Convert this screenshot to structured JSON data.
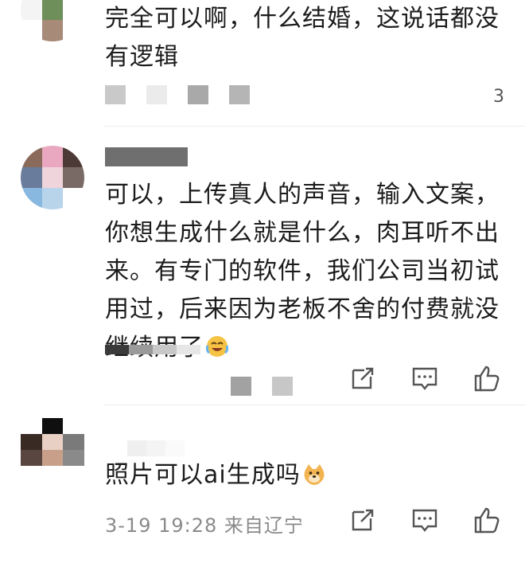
{
  "comments": [
    {
      "text": "完全可以啊，什么结婚，这说话都没有逻辑",
      "like_count": "3"
    },
    {
      "text": "可以，上传真人的声音，输入文案，你想生成什么就是什么，肉耳听不出来。有专门的软件，我们公司当初试用过，后来因为老板不舍的付费就没继续用了",
      "emoji": "laughing-crying-emoji",
      "actions": {
        "share": "share-icon",
        "reply": "comment-icon",
        "like": "thumbs-up-icon"
      }
    },
    {
      "text": "照片可以ai生成吗",
      "emoji": "doge-emoji",
      "meta": "3-19 19:28 来自辽宁",
      "actions": {
        "share": "share-icon",
        "reply": "comment-icon",
        "like": "thumbs-up-icon"
      }
    }
  ],
  "colors": {
    "text": "#1c1c1c",
    "meta": "#8a8a8a",
    "icon": "#555555",
    "divider": "#ededed"
  }
}
